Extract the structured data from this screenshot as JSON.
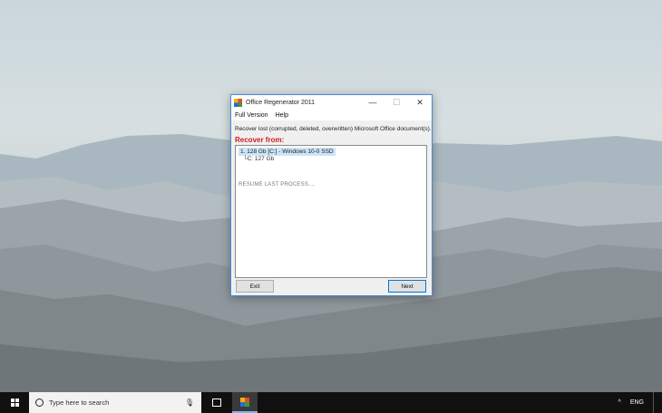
{
  "window": {
    "title": "Office Regenerator 2011",
    "controls": {
      "minimize": "—",
      "maximize": "☐",
      "close": "✕"
    },
    "menu": [
      "Full Version",
      "Help"
    ],
    "description": "Recover lost (corrupted, deleted, overwritten) Microsoft Office document(s).",
    "recover_label": "Recover from:",
    "drives": [
      {
        "label": "1. 128 Gb [C:] - Windows 10-0 SSD",
        "selected": true
      },
      {
        "label": "C: 127 Gb",
        "selected": false
      }
    ],
    "tree_prefix": "└",
    "resume": "RESUME LAST PROCESS....",
    "buttons": {
      "exit": "Exit",
      "next": "Next"
    }
  },
  "taskbar": {
    "search_placeholder": "Type here to search",
    "mic_icon": "🎙",
    "tray_up_icon": "^",
    "language": "ENG"
  },
  "colors": {
    "accent": "#0078d7",
    "recover_red": "#d11a1a",
    "selection": "#cce4f7"
  }
}
